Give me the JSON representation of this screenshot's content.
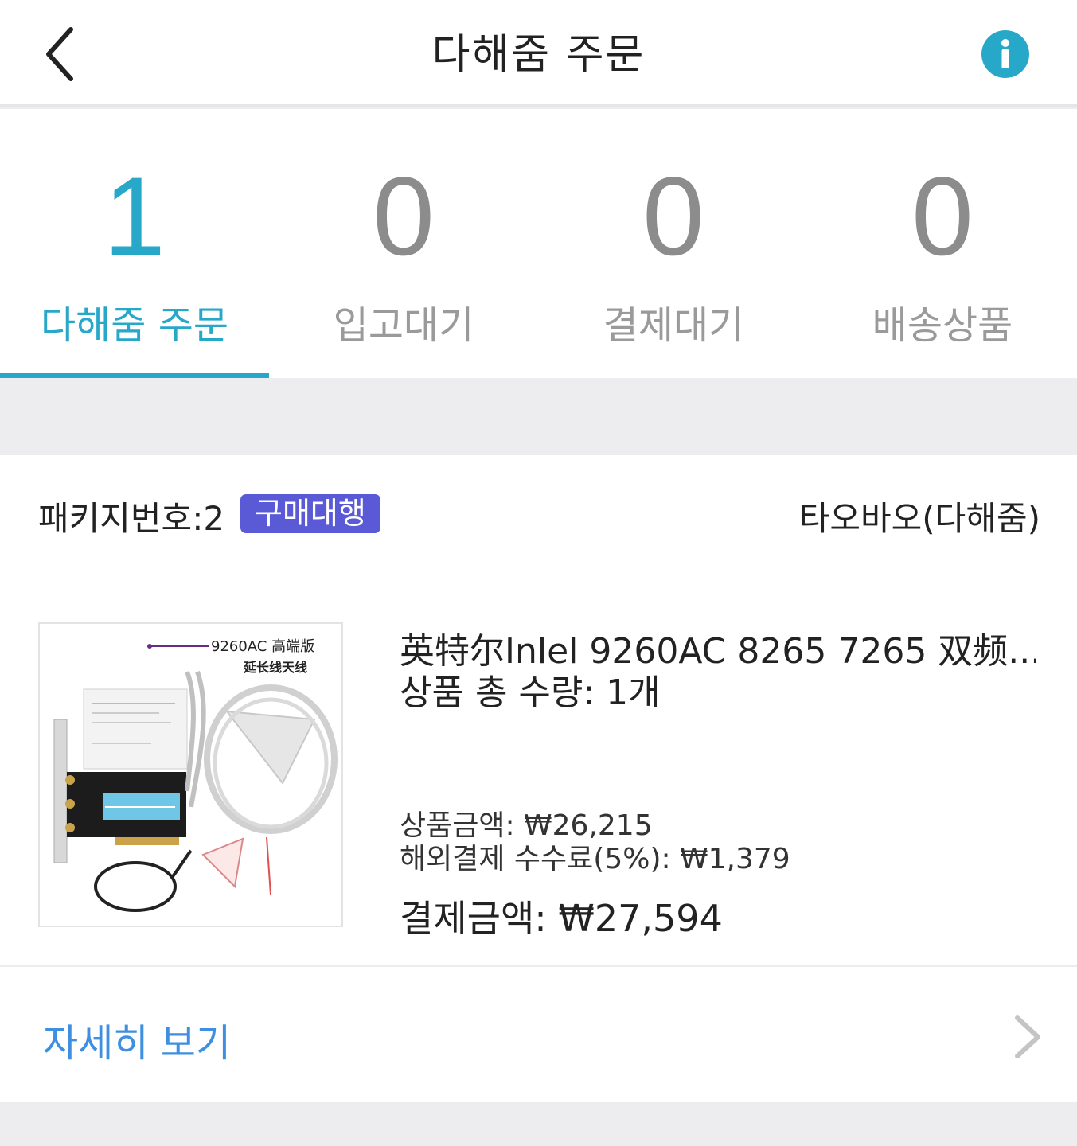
{
  "header": {
    "title": "다해줌 주문",
    "back_icon": "chevron-left-icon",
    "info_icon": "info-icon",
    "accent_color": "#27a8c9"
  },
  "stats": [
    {
      "count": "1",
      "label": "다해줌 주문",
      "active": true
    },
    {
      "count": "0",
      "label": "입고대기",
      "active": false
    },
    {
      "count": "0",
      "label": "결제대기",
      "active": false
    },
    {
      "count": "0",
      "label": "배송상품",
      "active": false
    }
  ],
  "package": {
    "number_label": "패키지번호:2",
    "badge": "구매대행",
    "badge_color": "#5a5ad6",
    "store": "타오바오(다해줌)"
  },
  "product": {
    "image_text_1": "9260AC 高端版",
    "image_text_2": "延长线天线",
    "name": "英特尔Inlel 9260AC 8265 7265 双频...",
    "quantity": "상품 총 수량: 1개",
    "price": "상품금액: ₩26,215",
    "fee": "해외결제 수수료(5%): ₩1,379",
    "total": "결제금액: ₩27,594"
  },
  "details": {
    "label": "자세히 보기",
    "icon": "chevron-right-icon"
  }
}
